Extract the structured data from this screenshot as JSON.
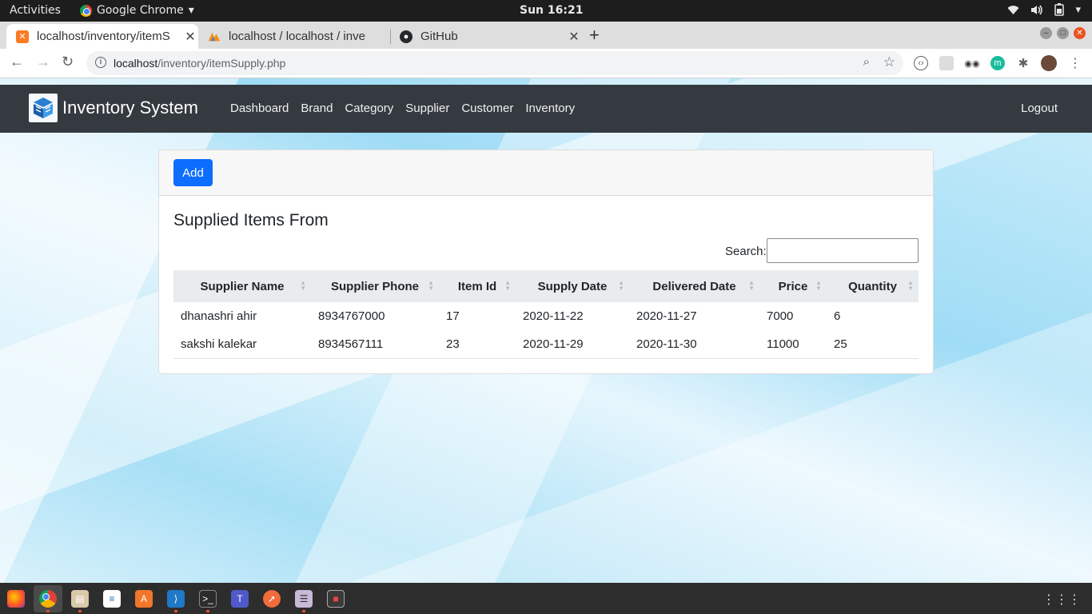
{
  "topbar": {
    "activities": "Activities",
    "app_name": "Google Chrome",
    "clock": "Sun 16:21",
    "tray": [
      "wifi-icon",
      "volume-icon",
      "battery-icon",
      "chevron-down-icon"
    ]
  },
  "tabs": [
    {
      "title": "localhost/inventory/itemS",
      "favicon": "xampp-icon"
    },
    {
      "title": "localhost / localhost / inve",
      "favicon": "phpmyadmin-icon"
    },
    {
      "title": "GitHub",
      "favicon": "github-icon"
    }
  ],
  "address": {
    "host": "localhost",
    "path": "/inventory/itemSupply.php"
  },
  "navbar": {
    "brand": "Inventory System",
    "links": [
      "Dashboard",
      "Brand",
      "Category",
      "Supplier",
      "Customer",
      "Inventory"
    ],
    "logout": "Logout"
  },
  "card": {
    "add_label": "Add",
    "title": "Supplied Items From",
    "search_label": "Search:",
    "columns": [
      "Supplier Name",
      "Supplier Phone",
      "Item Id",
      "Supply Date",
      "Delivered Date",
      "Price",
      "Quantity"
    ],
    "rows": [
      [
        "dhanashri ahir",
        "8934767000",
        "17",
        "2020-11-22",
        "2020-11-27",
        "7000",
        "6"
      ],
      [
        "sakshi kalekar",
        "8934567111",
        "23",
        "2020-11-29",
        "2020-11-30",
        "11000",
        "25"
      ]
    ]
  },
  "colors": {
    "navbar": "#343a40",
    "accent": "#0d6efd",
    "ubuntu_orange": "#e95420"
  }
}
